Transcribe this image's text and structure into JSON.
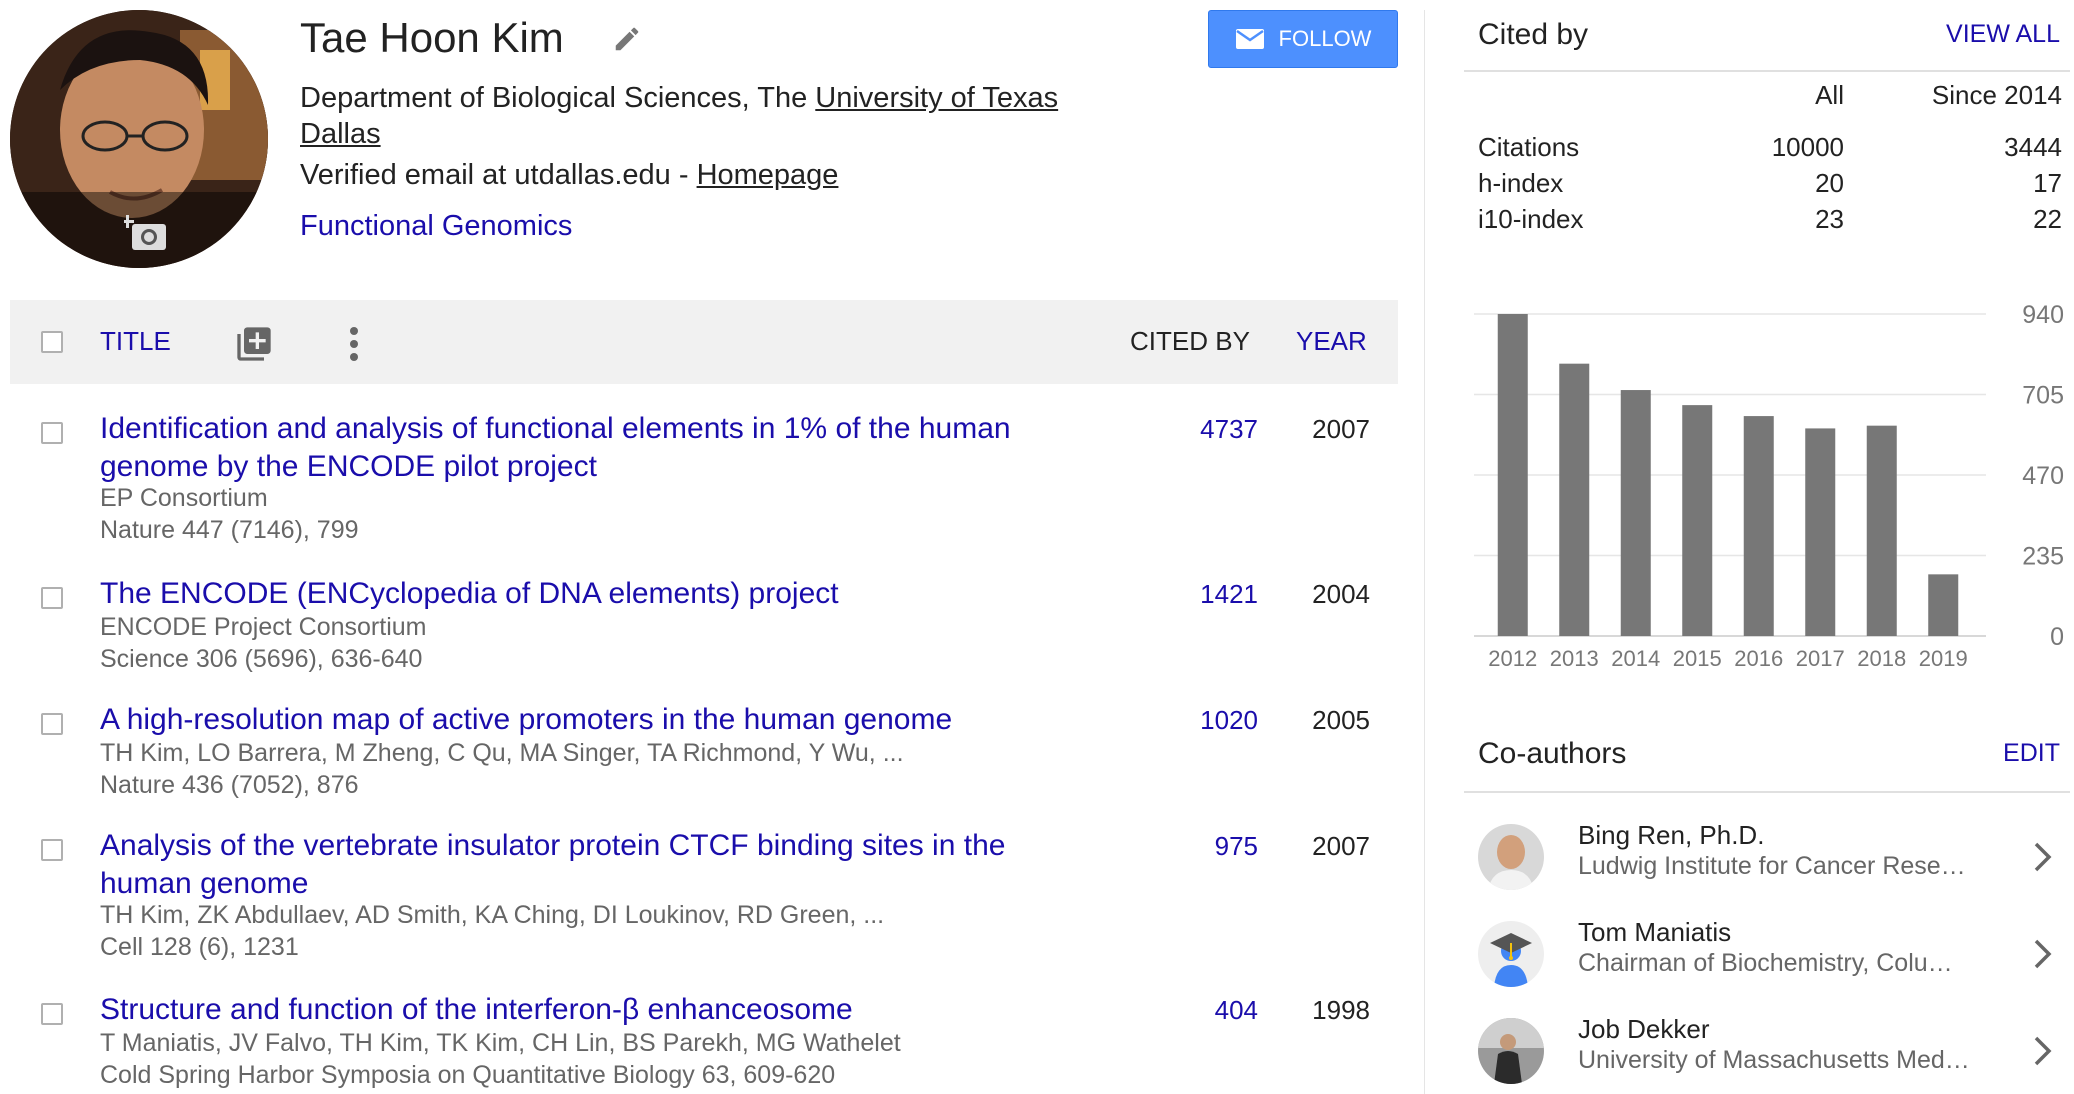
{
  "profile": {
    "name": "Tae Hoon Kim",
    "affiliation_prefix": "Department of Biological Sciences, The ",
    "affiliation_link": "University of Texas Dallas",
    "email": "Verified email at utdallas.edu - ",
    "homepage": "Homepage",
    "interest": "Functional Genomics",
    "follow_label": "FOLLOW"
  },
  "table": {
    "title_header": "TITLE",
    "cited_header": "CITED BY",
    "year_header": "YEAR"
  },
  "articles": [
    {
      "title": "Identification and analysis of functional elements in 1% of the human genome by the ENCODE pilot project",
      "authors": "EP Consortium",
      "venue": "Nature 447 (7146), 799",
      "cited": "4737",
      "year": "2007"
    },
    {
      "title": "The ENCODE (ENCyclopedia of DNA elements) project",
      "authors": "ENCODE Project Consortium",
      "venue": "Science 306 (5696), 636-640",
      "cited": "1421",
      "year": "2004"
    },
    {
      "title": "A high-resolution map of active promoters in the human genome",
      "authors": "TH Kim, LO Barrera, M Zheng, C Qu, MA Singer, TA Richmond, Y Wu, ...",
      "venue": "Nature 436 (7052), 876",
      "cited": "1020",
      "year": "2005"
    },
    {
      "title": "Analysis of the vertebrate insulator protein CTCF binding sites in the human genome",
      "authors": "TH Kim, ZK Abdullaev, AD Smith, KA Ching, DI Loukinov, RD Green, ...",
      "venue": "Cell 128 (6), 1231",
      "cited": "975",
      "year": "2007"
    },
    {
      "title": "Structure and function of the interferon-β enhanceosome",
      "authors": "T Maniatis, JV Falvo, TH Kim, TK Kim, CH Lin, BS Parekh, MG Wathelet",
      "venue": "Cold Spring Harbor Symposia on Quantitative Biology 63, 609-620",
      "cited": "404",
      "year": "1998"
    }
  ],
  "cited_by": {
    "title": "Cited by",
    "view_all": "VIEW ALL",
    "col_all": "All",
    "col_since": "Since 2014",
    "rows": [
      {
        "label": "Citations",
        "all": "10000",
        "since": "3444"
      },
      {
        "label": "h-index",
        "all": "20",
        "since": "17"
      },
      {
        "label": "i10-index",
        "all": "23",
        "since": "22"
      }
    ]
  },
  "chart_data": {
    "type": "bar",
    "categories": [
      "2012",
      "2013",
      "2014",
      "2015",
      "2016",
      "2017",
      "2018",
      "2019"
    ],
    "values": [
      940,
      795,
      718,
      674,
      642,
      606,
      614,
      180
    ],
    "y_ticks": [
      "0",
      "235",
      "470",
      "705",
      "940"
    ],
    "ylim": [
      0,
      940
    ],
    "grid": true,
    "bar_color": "#777777"
  },
  "coauthors": {
    "title": "Co-authors",
    "edit": "EDIT",
    "items": [
      {
        "name": "Bing Ren, Ph.D.",
        "affiliation": "Ludwig Institute for Cancer Rese…"
      },
      {
        "name": "Tom Maniatis",
        "affiliation": "Chairman of Biochemistry, Colu…"
      },
      {
        "name": "Job Dekker",
        "affiliation": "University of Massachusetts Med…"
      }
    ]
  }
}
